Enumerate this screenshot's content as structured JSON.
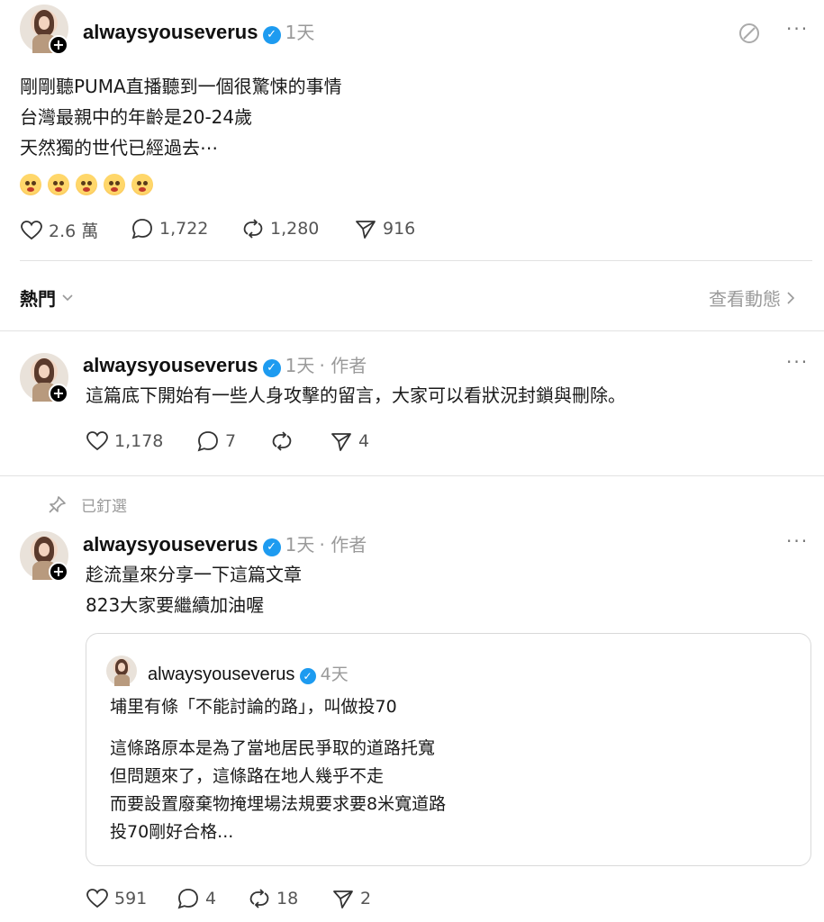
{
  "post": {
    "username": "alwaysyouseverus",
    "time": "1天",
    "lines": [
      "剛剛聽PUMA直播聽到一個很驚悚的事情",
      "台灣最親中的年齡是20-24歲",
      "天然獨的世代已經過去⋯"
    ],
    "emoji_count": 5,
    "likes": "2.6 萬",
    "comments": "1,722",
    "reposts": "1,280",
    "shares": "916"
  },
  "sort": {
    "label": "熱門",
    "view_activity": "查看動態"
  },
  "reply1": {
    "username": "alwaysyouseverus",
    "time": "1天",
    "author_tag": "作者",
    "text": "這篇底下開始有一些人身攻擊的留言，大家可以看狀況封鎖與刪除。",
    "likes": "1,178",
    "comments": "7",
    "shares": "4"
  },
  "reply2": {
    "pinned_label": "已釘選",
    "username": "alwaysyouseverus",
    "time": "1天",
    "author_tag": "作者",
    "lines": [
      "趁流量來分享一下這篇文章",
      "823大家要繼續加油喔"
    ],
    "likes": "591",
    "comments": "4",
    "reposts": "18",
    "shares": "2"
  },
  "quoted": {
    "username": "alwaysyouseverus",
    "time": "4天",
    "line1": "埔里有條「不能討論的路」，叫做投70",
    "lines": [
      "這條路原本是為了當地居民爭取的道路托寬",
      "但問題來了，這條路在地人幾乎不走",
      "而要設置廢棄物掩埋場法規要求要8米寬道路",
      "投70剛好合格..."
    ]
  },
  "colors": {
    "verified": "#1d9bf0",
    "meta": "#9a9a9a",
    "divider": "#e2e2e2"
  },
  "icons": [
    "heart-icon",
    "comment-icon",
    "repost-icon",
    "share-icon",
    "pin-icon",
    "more-icon",
    "activity-icon",
    "chevron-down-icon",
    "chevron-right-icon",
    "verified-icon",
    "plus-icon"
  ]
}
